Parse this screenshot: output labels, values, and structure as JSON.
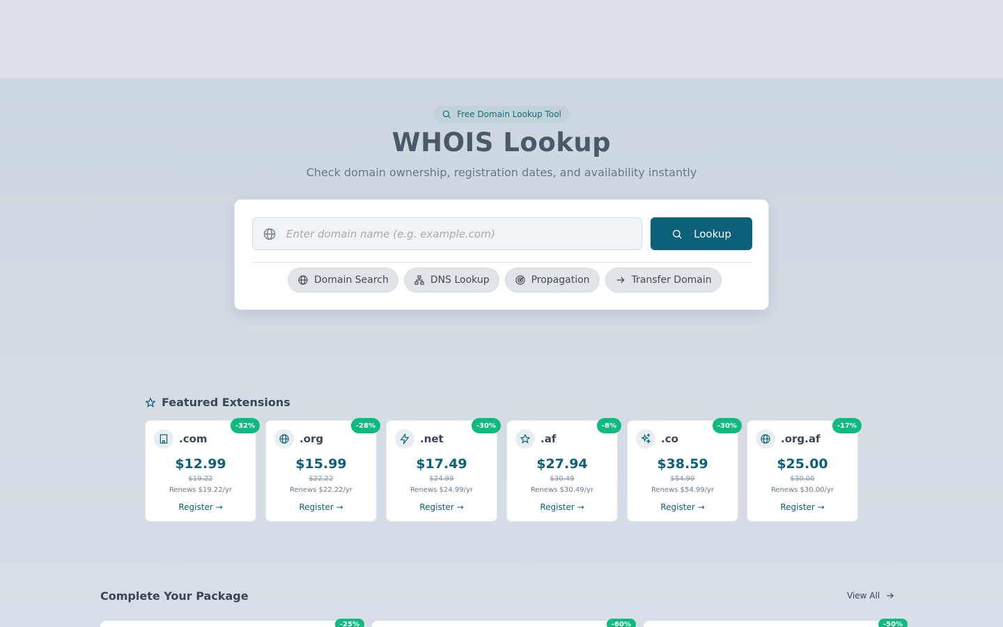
{
  "hero": {
    "badge": "Free Domain Lookup Tool",
    "title": "WHOIS Lookup",
    "subtitle": "Check domain ownership, registration dates, and availability instantly"
  },
  "search": {
    "placeholder": "Enter domain name (e.g. example.com)",
    "button_label": "Lookup"
  },
  "tools": [
    {
      "label": "Domain Search",
      "icon": "globe-icon"
    },
    {
      "label": "DNS Lookup",
      "icon": "network-icon"
    },
    {
      "label": "Propagation",
      "icon": "radar-icon"
    },
    {
      "label": "Transfer Domain",
      "icon": "arrow-right-icon"
    }
  ],
  "featured": {
    "heading": "Featured Extensions",
    "items": [
      {
        "tld": ".com",
        "icon": "building-icon",
        "discount": "-32%",
        "price": "$12.99",
        "old_price": "$19.22",
        "renew": "Renews $19.22/yr",
        "cta": "Register →"
      },
      {
        "tld": ".org",
        "icon": "globe-icon",
        "discount": "-28%",
        "price": "$15.99",
        "old_price": "$22.22",
        "renew": "Renews $22.22/yr",
        "cta": "Register →"
      },
      {
        "tld": ".net",
        "icon": "bolt-icon",
        "discount": "-30%",
        "price": "$17.49",
        "old_price": "$24.99",
        "renew": "Renews $24.99/yr",
        "cta": "Register →"
      },
      {
        "tld": ".af",
        "icon": "star-icon",
        "discount": "-8%",
        "price": "$27.94",
        "old_price": "$30.49",
        "renew": "Renews $30.49/yr",
        "cta": "Register →"
      },
      {
        "tld": ".co",
        "icon": "sparkles-icon",
        "discount": "-30%",
        "price": "$38.59",
        "old_price": "$54.99",
        "renew": "Renews $54.99/yr",
        "cta": "Register →"
      },
      {
        "tld": ".org.af",
        "icon": "globe-icon",
        "discount": "-17%",
        "price": "$25.00",
        "old_price": "$30.00",
        "renew": "Renews $30.00/yr",
        "cta": "Register →"
      }
    ]
  },
  "package": {
    "heading": "Complete Your Package",
    "view_all": "View All",
    "discounts": [
      "-25%",
      "-60%",
      "-50%"
    ]
  },
  "colors": {
    "accent": "#0d6079",
    "discount": "#10b981",
    "background": "#d8dee7"
  }
}
